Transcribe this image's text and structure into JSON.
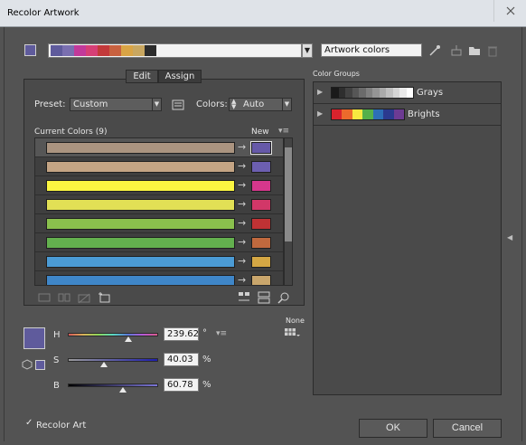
{
  "window": {
    "title": "Recolor Artwork"
  },
  "top": {
    "harmony_colors": [
      "#5f5b9c",
      "#7a6fb0",
      "#c2399a",
      "#d63f76",
      "#c2393a",
      "#c8613f",
      "#d9a445",
      "#c9a760",
      "#2c2c2c"
    ],
    "name_field": "Artwork colors"
  },
  "tabs": {
    "edit": "Edit",
    "assign": "Assign"
  },
  "preset": {
    "label": "Preset:",
    "value": "Custom"
  },
  "colors": {
    "label": "Colors:",
    "value": "Auto"
  },
  "table": {
    "current_label": "Current Colors (9)",
    "new_label": "New",
    "rows": [
      {
        "current": "#ab9480",
        "new": "#6659a8"
      },
      {
        "current": "#c4a484",
        "new": "#6c5fb0"
      },
      {
        "current": "#fbf641",
        "new": "#d6378c"
      },
      {
        "current": "#e2e055",
        "new": "#d23768"
      },
      {
        "current": "#8ac04d",
        "new": "#bf3234"
      },
      {
        "current": "#63b04e",
        "new": "#c0693e"
      },
      {
        "current": "#4b9bd5",
        "new": "#d4a744"
      },
      {
        "current": "#3f86c8",
        "new": "#c9a66c"
      }
    ]
  },
  "groups": {
    "header": "Color Groups",
    "items": [
      {
        "name": "Grays",
        "swatches": [
          "#1a1a1a",
          "#2e2e2e",
          "#424242",
          "#565656",
          "#6b6b6b",
          "#808080",
          "#959595",
          "#aaaaaa",
          "#bfbfbf",
          "#d4d4d4",
          "#eaeaea",
          "#ffffff"
        ]
      },
      {
        "name": "Brights",
        "swatches": [
          "#d9232d",
          "#ec6a2c",
          "#f7e940",
          "#55b04a",
          "#2d6fb7",
          "#2b3a8f",
          "#6d3b93"
        ]
      }
    ]
  },
  "hsb": {
    "h": {
      "label": "H",
      "value": "239.62",
      "unit": "°",
      "fraction": 0.6656
    },
    "s": {
      "label": "S",
      "value": "40.03",
      "unit": "%",
      "fraction": 0.4003
    },
    "b": {
      "label": "B",
      "value": "60.78",
      "unit": "%",
      "fraction": 0.6078
    }
  },
  "selected_color": "#5f5b9c",
  "none_label": "None",
  "recolor": {
    "label": "Recolor Art",
    "checked": true
  },
  "buttons": {
    "ok": "OK",
    "cancel": "Cancel"
  },
  "icons": [
    "eyedropper-icon",
    "new-group-icon",
    "folder-icon",
    "trash-icon",
    "color-swatches-icon"
  ]
}
